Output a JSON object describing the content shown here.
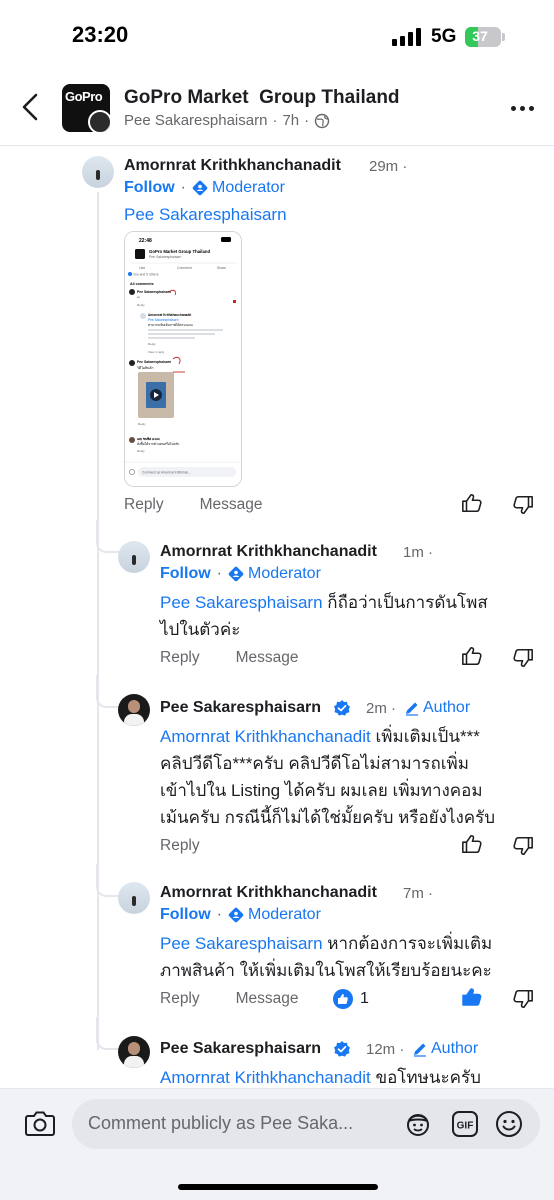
{
  "status_bar": {
    "time": "23:20",
    "network": "5G",
    "battery": "37",
    "battery_level": 0.37
  },
  "header": {
    "group_name": "GoPro Market  Group Thailand",
    "poster": "Pee Sakaresphaisarn",
    "posted_ago": "7h",
    "logo_text": "GoPro"
  },
  "comments": [
    {
      "name": "Amornrat Krithkhanchanadit",
      "time": "29m",
      "follow": "Follow",
      "badge": "Moderator",
      "mention": "Pee Sakaresphaisarn",
      "text": "",
      "actions": {
        "reply": "Reply",
        "message": "Message"
      }
    },
    {
      "name": "Amornrat Krithkhanchanadit",
      "time": "1m",
      "follow": "Follow",
      "badge": "Moderator",
      "mention": "Pee Sakaresphaisarn",
      "text_l1": "ก็ถือว่าเป็นการดันโพส",
      "text_l2": "ไปในตัวค่ะ",
      "actions": {
        "reply": "Reply",
        "message": "Message"
      }
    },
    {
      "name": "Pee Sakaresphaisarn",
      "time": "2m",
      "badge": "Author",
      "mention": "Amornrat Krithkhanchanadit",
      "text_l1": "เพิ่มเติมเป็น***",
      "text_l2": "คลิปวีดีโอ***ครับ คลิปวีดีโอไม่สามารถเพิ่ม",
      "text_l3": "เข้าไปใน Listing ได้ครับ ผมเลย เพิ่มทางคอม",
      "text_l4": "เม้นครับ กรณีนี้ก็ไม่ได้ใช่มั้ยครับ หรือยังไงครับ",
      "actions": {
        "reply": "Reply"
      }
    },
    {
      "name": "Amornrat Krithkhanchanadit",
      "time": "7m",
      "follow": "Follow",
      "badge": "Moderator",
      "mention": "Pee Sakaresphaisarn",
      "text_l1": "หากต้องการจะเพิ่มเติม",
      "text_l2": "ภาพสินค้า ให้เพิ่มเติมในโพสให้เรียบร้อยนะคะ",
      "actions": {
        "reply": "Reply",
        "message": "Message"
      },
      "like_count": "1"
    },
    {
      "name": "Pee Sakaresphaisarn",
      "time": "12m",
      "badge": "Author",
      "mention": "Amornrat Krithkhanchanadit",
      "text_l1": "ขอโทษนะครับ"
    }
  ],
  "screenshot_image": {
    "time": "22:48",
    "group_name": "GoPro Market  Group Thailand",
    "poster": "Pee Sakaresphaisarn",
    "like": "Like",
    "comment": "Comment",
    "share": "Share",
    "reactions": "You and 9 others",
    "all_comments": "All comments",
    "c1_name": "Pee Sakaresphaisarn",
    "c2_name": "Amornrat Krithkhanchanadit",
    "c2_mention": "Pee Sakaresphaisarn",
    "c2_text": "สามารถเพิ่มเติมภาพได้ตามนะคะ",
    "view_reply": "View 1 reply",
    "c3_name": "Pee Sakaresphaisarn",
    "c3_text": "วิดีโอสินค้า",
    "reply": "Reply",
    "c4_name": "เดย ชมพิศ คงแจ",
    "c4_text": "สั่งซื้อได้จากตัวแทนหรือไม่ครับ",
    "composer": "Comment as Amornrat Krithkhan..."
  },
  "composer": {
    "placeholder": "Comment publicly as Pee Saka..."
  },
  "colors": {
    "accent": "#1877f2",
    "secondary_text": "#65676b",
    "thread_line": "#e4e6eb",
    "composer_bg": "#f0f2f5"
  },
  "icons": [
    "back-chevron-icon",
    "globe-icon",
    "more-icon",
    "moderator-badge-icon",
    "verified-icon",
    "author-pencil-icon",
    "thumbs-up-icon",
    "thumbs-down-icon",
    "camera-icon",
    "avatar-sticker-icon",
    "gif-icon",
    "emoji-icon"
  ]
}
